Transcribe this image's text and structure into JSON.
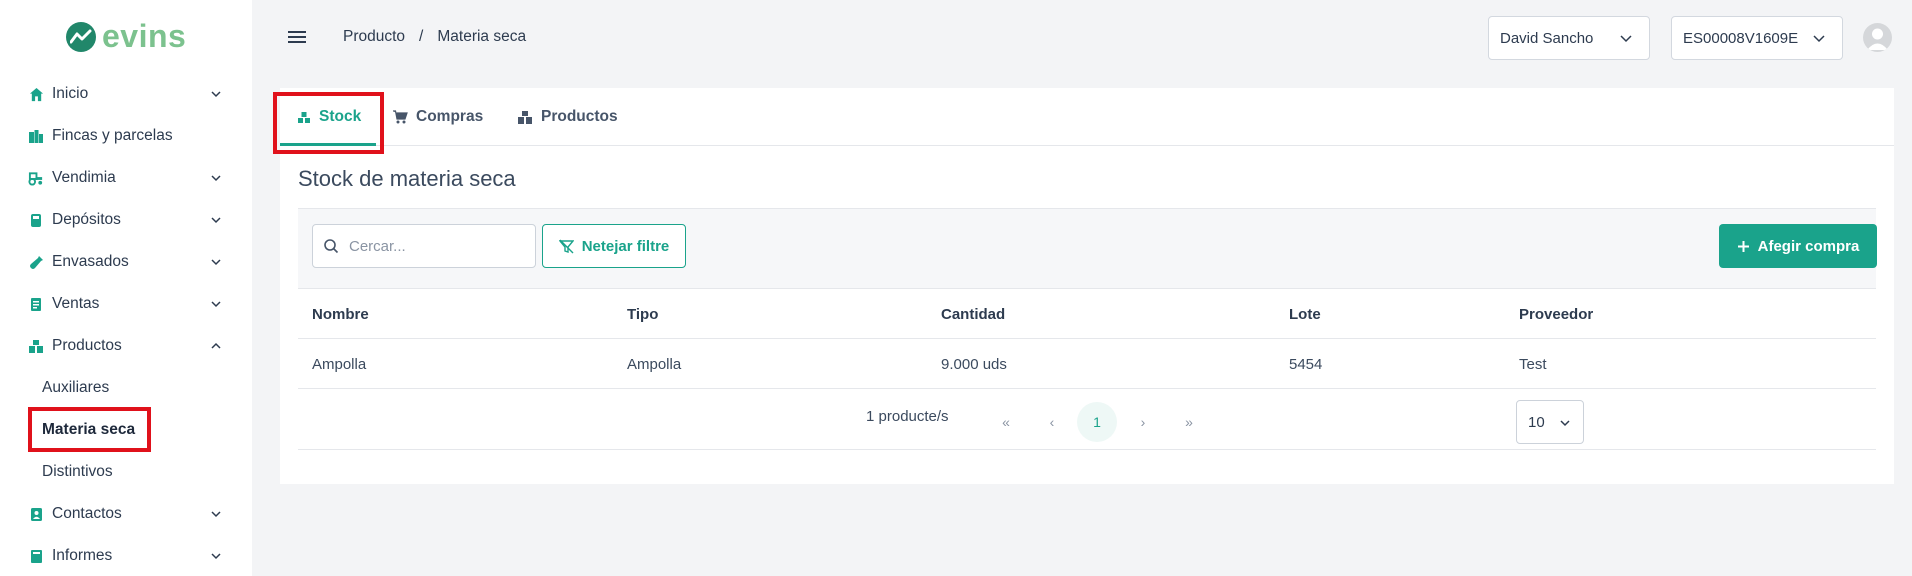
{
  "brand": {
    "name": "evins",
    "logo_color": "#21876a",
    "text_color": "#7cc28e"
  },
  "sidebar": {
    "items": [
      {
        "label": "Inicio",
        "icon": "home-icon",
        "expandable": true,
        "expanded": false
      },
      {
        "label": "Fincas y parcelas",
        "icon": "map-icon",
        "expandable": false
      },
      {
        "label": "Vendimia",
        "icon": "tractor-icon",
        "expandable": true,
        "expanded": false
      },
      {
        "label": "Depósitos",
        "icon": "tank-icon",
        "expandable": true,
        "expanded": false
      },
      {
        "label": "Envasados",
        "icon": "bottle-icon",
        "expandable": true,
        "expanded": false
      },
      {
        "label": "Ventas",
        "icon": "receipt-icon",
        "expandable": true,
        "expanded": false
      },
      {
        "label": "Productos",
        "icon": "boxes-icon",
        "expandable": true,
        "expanded": true,
        "children": [
          {
            "label": "Auxiliares",
            "active": false
          },
          {
            "label": "Materia seca",
            "active": true
          },
          {
            "label": "Distintivos",
            "active": false
          }
        ]
      },
      {
        "label": "Contactos",
        "icon": "contact-icon",
        "expandable": true,
        "expanded": false
      },
      {
        "label": "Informes",
        "icon": "book-icon",
        "expandable": true,
        "expanded": false
      }
    ]
  },
  "header": {
    "breadcrumb": [
      "Producto",
      "Materia seca"
    ],
    "breadcrumb_separator": "/",
    "user_select": "David Sancho",
    "company_select": "ES00008V1609E"
  },
  "tabs": [
    {
      "label": "Stock",
      "icon": "stock-icon",
      "active": true
    },
    {
      "label": "Compras",
      "icon": "cart-icon",
      "active": false
    },
    {
      "label": "Productos",
      "icon": "boxes-icon",
      "active": false
    }
  ],
  "panel": {
    "title": "Stock de materia seca",
    "search_placeholder": "Cercar...",
    "clear_filter_label": "Netejar filtre",
    "add_button_label": "Afegir compra"
  },
  "table": {
    "columns": [
      "Nombre",
      "Tipo",
      "Cantidad",
      "Lote",
      "Proveedor"
    ],
    "rows": [
      [
        "Ampolla",
        "Ampolla",
        "9.000 uds",
        "5454",
        "Test"
      ]
    ]
  },
  "pagination": {
    "count_text": "1 producte/s",
    "first": "«",
    "prev": "‹",
    "current_page": "1",
    "next": "›",
    "last": "»",
    "page_size": "10"
  },
  "colors": {
    "accent": "#1aa38b",
    "highlight_box": "#e0111b",
    "sidebar_icon": "#1aa38b"
  }
}
